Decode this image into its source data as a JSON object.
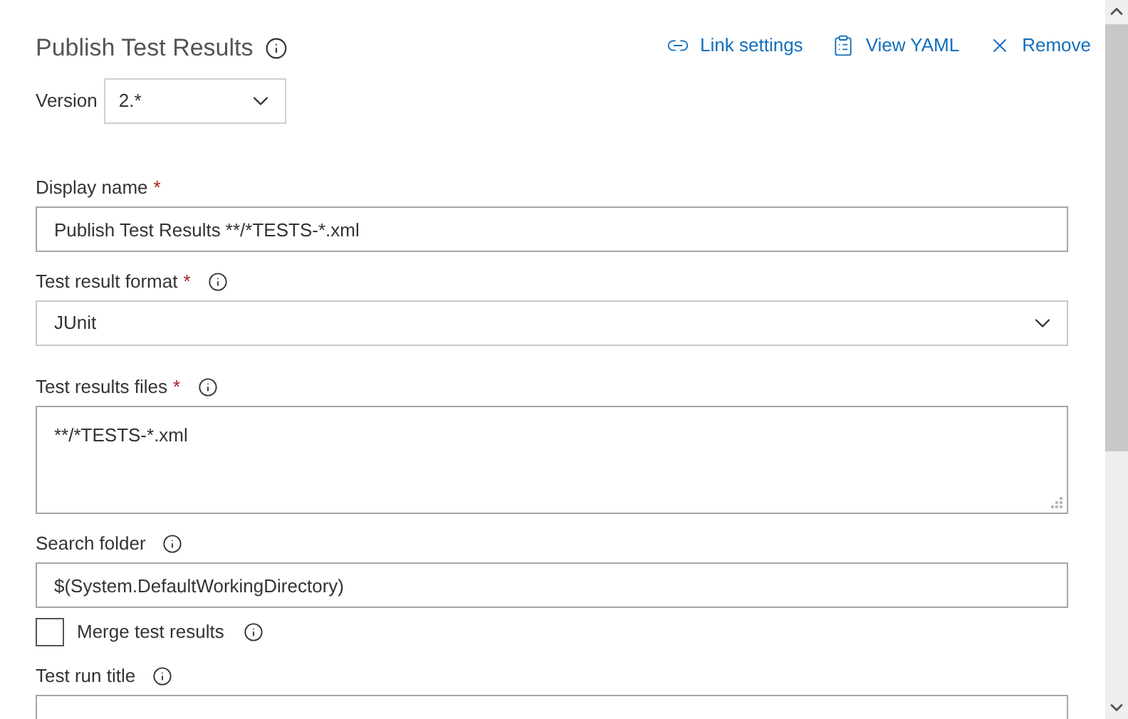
{
  "header": {
    "title": "Publish Test Results",
    "actions": [
      {
        "kind": "link",
        "label": "Link settings"
      },
      {
        "kind": "yaml",
        "label": "View YAML"
      },
      {
        "kind": "remove",
        "label": "Remove"
      }
    ]
  },
  "version": {
    "label": "Version",
    "value": "2.*"
  },
  "fields": [
    {
      "kind": "text",
      "label": "Display name",
      "required_mark": "*",
      "info": false,
      "value": "Publish Test Results **/*TESTS-*.xml"
    },
    {
      "kind": "select",
      "label": "Test result format",
      "required_mark": "*",
      "info": true,
      "value": "JUnit"
    },
    {
      "kind": "textarea",
      "label": "Test results files",
      "required_mark": "*",
      "info": true,
      "value": "**/*TESTS-*.xml"
    },
    {
      "kind": "text",
      "label": "Search folder",
      "info": true,
      "value": "$(System.DefaultWorkingDirectory)"
    },
    {
      "kind": "checkbox",
      "label": "Merge test results",
      "checked": false,
      "info": true
    },
    {
      "kind": "text",
      "label": "Test run title",
      "info": true
    }
  ]
}
